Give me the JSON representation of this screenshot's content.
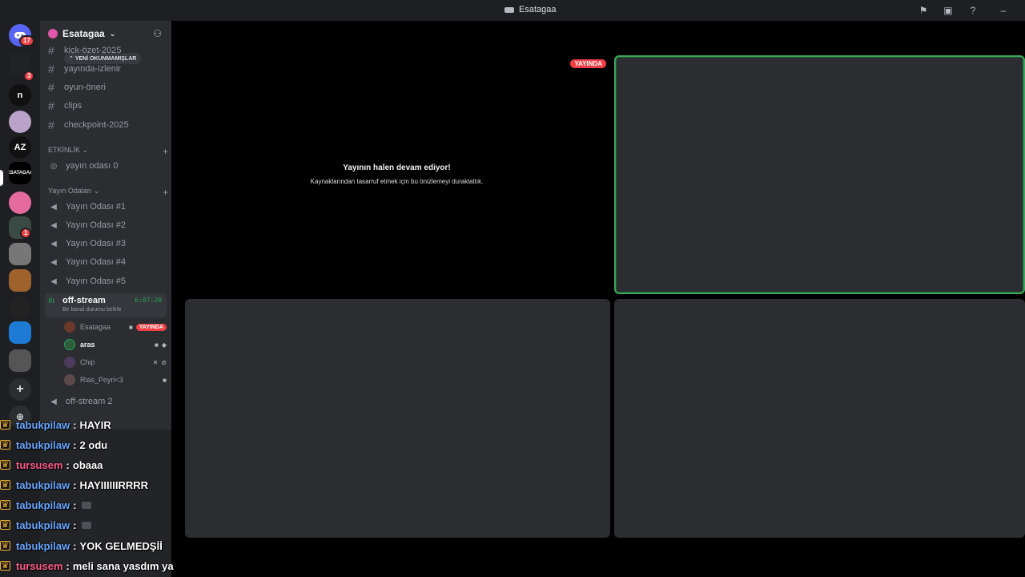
{
  "window": {
    "title": "Esatagaa"
  },
  "rail": {
    "home_badge": "17",
    "server_badges": [
      "3",
      "1"
    ],
    "servers": [
      "n",
      "AZ",
      "ESATAGAA"
    ]
  },
  "guild": {
    "name": "Esatagaa"
  },
  "unread_label": "YENİ OKUNMAMIŞLAR",
  "channels": [
    {
      "name": "kick-özet-2025"
    },
    {
      "name": "yayında-izlenir"
    },
    {
      "name": "oyun-öneri"
    },
    {
      "name": "clips"
    },
    {
      "name": "checkpoint-2025"
    }
  ],
  "categories": {
    "event": "ETKİNLİK",
    "streams": "Yayın Odaları"
  },
  "event_channel": "yayın odası 0",
  "voice_channels": [
    "Yayın Odası #1",
    "Yayın Odası #2",
    "Yayın Odası #3",
    "Yayın Odası #4",
    "Yayın Odası #5"
  ],
  "active_voice": {
    "name": "off-stream",
    "timer": "6:07:20",
    "status": "Bir kanal durumu belirle"
  },
  "voice_users": [
    {
      "name": "Esatagaa",
      "live": "YAYINDA"
    },
    {
      "name": "aras"
    },
    {
      "name": "Chip"
    },
    {
      "name": "Rias_Poyri<3"
    }
  ],
  "other_voice": "off-stream 2",
  "stage": {
    "live_label": "YAYINDA",
    "paused_title": "Yayının halen devam ediyor!",
    "paused_sub": "Kaynaklarından tasarruf etmek için bu önizlemeyi duraklattık."
  },
  "chat": [
    {
      "user": "tabukpilaw",
      "text": "HAYIR",
      "color": "blue"
    },
    {
      "user": "tabukpilaw",
      "text": "2 odu",
      "color": "blue"
    },
    {
      "user": "tursusem",
      "text": "obaaa",
      "color": "pink"
    },
    {
      "user": "tabukpilaw",
      "text": "HAYIIIIIIRRRR",
      "color": "blue"
    },
    {
      "user": "tabukpilaw",
      "text": "",
      "color": "blue",
      "emote": true
    },
    {
      "user": "tabukpilaw",
      "text": "",
      "color": "blue",
      "emote": true
    },
    {
      "user": "tabukpilaw",
      "text": "YOK GELMEDŞİİ",
      "color": "blue"
    },
    {
      "user": "tursusem",
      "text": "meli sana yasdım ya",
      "color": "pink"
    }
  ],
  "colors": {
    "accent_green": "#3ba55d",
    "live_red": "#f23f43",
    "user_blue": "#6aa6ff",
    "user_pink": "#ff5c8a"
  }
}
